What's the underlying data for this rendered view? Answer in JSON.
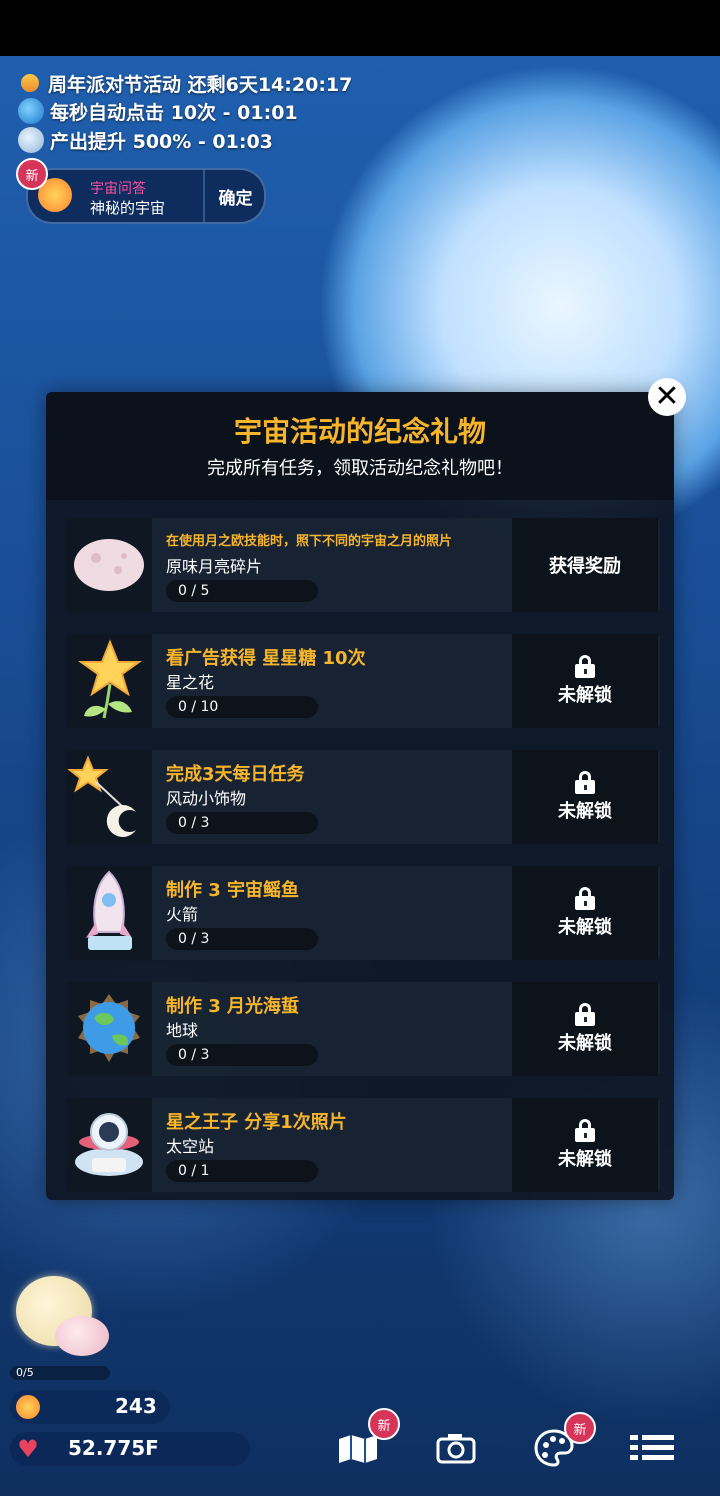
{
  "status": {
    "event_line": "周年派对节活动 还剩6天14:20:17",
    "autoclick_line": "每秒自动点击 10次 - 01:01",
    "boost_line": "产出提升 500% - 01:03"
  },
  "quiz": {
    "badge": "新",
    "title": "宇宙问答",
    "subtitle": "神秘的宇宙",
    "confirm_label": "确定"
  },
  "modal": {
    "title": "宇宙活动的纪念礼物",
    "subtitle": "完成所有任务，领取活动纪念礼物吧！",
    "close_glyph": "✕",
    "tasks": [
      {
        "title": "在使用月之欧技能时，照下不同的宇宙之月的照片",
        "name": "原味月亮碎片",
        "progress": "0 / 5",
        "button": "获得奖励",
        "locked": false,
        "icon": "moon-fragment-icon"
      },
      {
        "title": "看广告获得 星星糖 10次",
        "name": "星之花",
        "progress": "0 / 10",
        "button": "未解锁",
        "locked": true,
        "icon": "star-flower-icon"
      },
      {
        "title": "完成3天每日任务",
        "name": "风动小饰物",
        "progress": "0 / 3",
        "button": "未解锁",
        "locked": true,
        "icon": "wind-chime-icon"
      },
      {
        "title": "制作 3 宇宙鳐鱼",
        "name": "火箭",
        "progress": "0 / 3",
        "button": "未解锁",
        "locked": true,
        "icon": "rocket-icon"
      },
      {
        "title": "制作 3 月光海蜇",
        "name": "地球",
        "progress": "0 / 3",
        "button": "未解锁",
        "locked": true,
        "icon": "earth-icon"
      },
      {
        "title": "星之王子 分享1次照片",
        "name": "太空站",
        "progress": "0 / 1",
        "button": "未解锁",
        "locked": true,
        "icon": "space-station-icon"
      }
    ]
  },
  "bottom": {
    "mini_progress": "0/5",
    "stardust": "243",
    "hearts": "52.775F",
    "nav": [
      {
        "icon": "map-icon",
        "badge": "新"
      },
      {
        "icon": "camera-icon",
        "badge": ""
      },
      {
        "icon": "palette-icon",
        "badge": "新"
      },
      {
        "icon": "menu-list-icon",
        "badge": ""
      }
    ]
  },
  "colors": {
    "accent": "#f7b52c",
    "badge": "#d7345a",
    "heart": "#e8425f"
  }
}
